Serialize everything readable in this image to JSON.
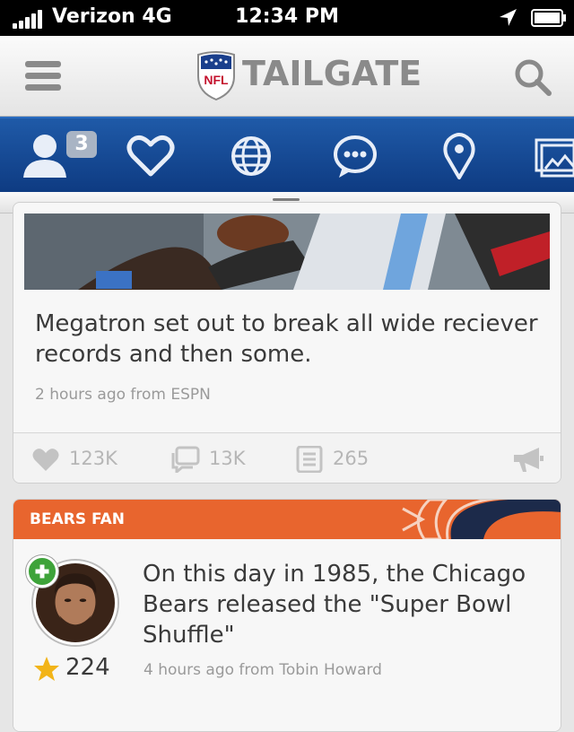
{
  "status_bar": {
    "carrier": "Verizon 4G",
    "time": "12:34 PM"
  },
  "header": {
    "logo_text": "NFL",
    "title": "TAILGATE"
  },
  "nav": {
    "badge_count": "3",
    "items": [
      "profile-icon",
      "heart-icon",
      "globe-icon",
      "chat-icon",
      "location-pin-icon",
      "gallery-icon"
    ]
  },
  "feed": [
    {
      "headline": "Megatron set out to break all wide reciever records and then some.",
      "meta": "2 hours ago from ESPN",
      "actions": {
        "likes": "123K",
        "comments": "13K",
        "articles": "265"
      }
    },
    {
      "banner": "BEARS FAN",
      "headline": "On this day in 1985, the Chicago Bears released the \"Super Bowl Shuffle\"",
      "meta": "4 hours ago from Tobin Howard",
      "score": "224"
    }
  ],
  "colors": {
    "nav_blue": "#1a4e9a",
    "bears_orange": "#e8652e",
    "follow_green": "#3ea33a",
    "star_gold": "#f2b418"
  }
}
